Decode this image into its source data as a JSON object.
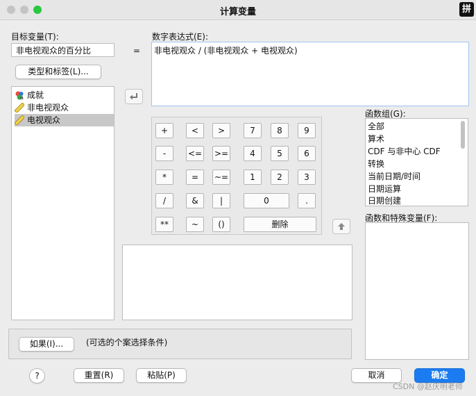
{
  "window": {
    "title": "计算变量",
    "ime_indicator": "拼"
  },
  "target": {
    "label": "目标变量(T):",
    "value": "非电视观众的百分比"
  },
  "equals": "=",
  "expression": {
    "label": "数字表达式(E):",
    "value": "非电视观众 / (非电视观众 + 电视观众)"
  },
  "type_label_button": "类型和标签(L)...",
  "variables": [
    {
      "name": "成就",
      "icon": "nominal-icon"
    },
    {
      "name": "非电视观众",
      "icon": "scale-icon"
    },
    {
      "name": "电视观众",
      "icon": "scale-icon",
      "selected": true
    }
  ],
  "keypad": {
    "row1": [
      "+",
      "<",
      ">",
      "7",
      "8",
      "9"
    ],
    "row2": [
      "-",
      "<=",
      ">=",
      "4",
      "5",
      "6"
    ],
    "row3": [
      "*",
      "=",
      "~=",
      "1",
      "2",
      "3"
    ],
    "row4": [
      "/",
      "&",
      "|",
      "0",
      "."
    ],
    "row5": [
      "**",
      "~",
      "()",
      "删除"
    ]
  },
  "function_group": {
    "label": "函数组(G):",
    "items": [
      "全部",
      "算术",
      "CDF 与非中心 CDF",
      "转换",
      "当前日期/时间",
      "日期运算",
      "日期创建"
    ]
  },
  "functions": {
    "label": "函数和特殊变量(F):"
  },
  "if_button": "如果(I)...",
  "if_text": "(可选的个案选择条件)",
  "buttons": {
    "help": "?",
    "reset": "重置(R)",
    "paste": "粘贴(P)",
    "cancel": "取消",
    "ok": "确定"
  },
  "watermark": "CSDN @赵庆明老师",
  "colors": {
    "accent": "#1a7cf0",
    "selection": "#c8c8c8"
  }
}
